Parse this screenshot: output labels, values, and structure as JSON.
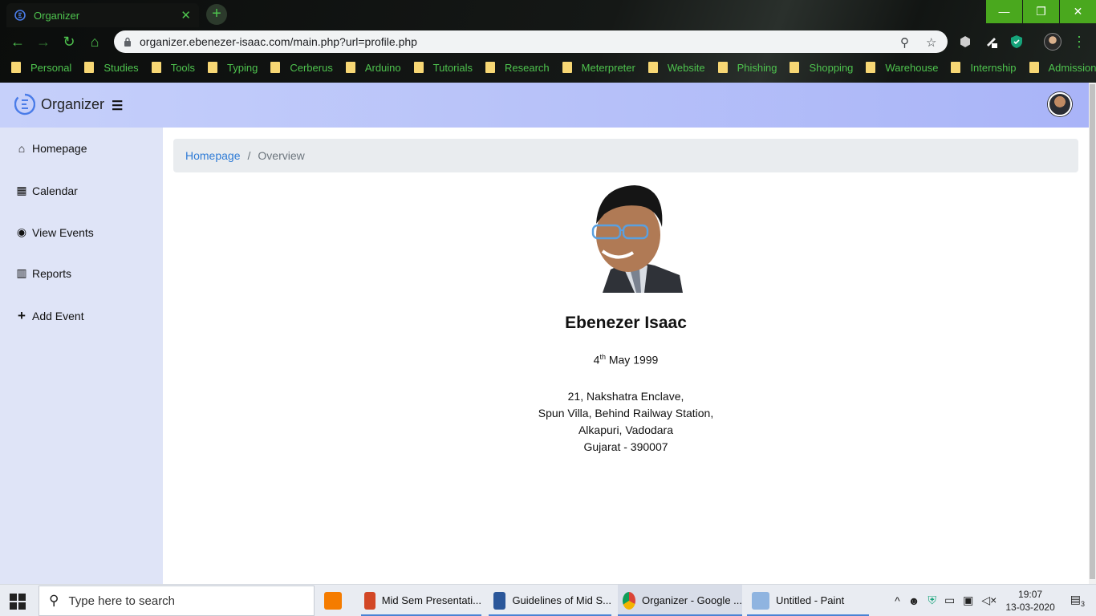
{
  "browser": {
    "tab_title": "Organizer",
    "url": "organizer.ebenezer-isaac.com/main.php?url=profile.php",
    "bookmarks": [
      "Personal",
      "Studies",
      "Tools",
      "Typing",
      "Cerberus",
      "Arduino",
      "Tutorials",
      "Research",
      "Meterpreter",
      "Website",
      "Phishing",
      "Shopping",
      "Warehouse",
      "Internship",
      "Admission"
    ]
  },
  "app": {
    "brand": "Organizer"
  },
  "sidebar": {
    "items": [
      {
        "label": "Homepage",
        "icon": "home-icon"
      },
      {
        "label": "Calendar",
        "icon": "calendar-icon"
      },
      {
        "label": "View Events",
        "icon": "eye-icon"
      },
      {
        "label": "Reports",
        "icon": "bar-chart-icon"
      },
      {
        "label": "Add Event",
        "icon": "plus-icon"
      }
    ]
  },
  "breadcrumb": {
    "home": "Homepage",
    "separator": "/",
    "current": "Overview"
  },
  "profile": {
    "name": "Ebenezer Isaac",
    "dob_day": "4",
    "dob_suffix": "th",
    "dob_rest": "May 1999",
    "address": [
      "21, Nakshatra Enclave,",
      "Spun Villa, Behind Railway Station,",
      "Alkapuri, Vadodara",
      "Gujarat - 390007"
    ]
  },
  "taskbar": {
    "search_placeholder": "Type here to search",
    "apps": [
      "Mid Sem Presentati...",
      "Guidelines of Mid S...",
      "Organizer - Google ...",
      "Untitled - Paint"
    ],
    "time": "19:07",
    "date": "13-03-2020",
    "notification_count": "3"
  },
  "colors": {
    "accent_green": "#4ec34e",
    "header_gradient_start": "#c6d0fa",
    "sidebar_bg": "#dfe4f7",
    "link": "#2e7bd6"
  }
}
